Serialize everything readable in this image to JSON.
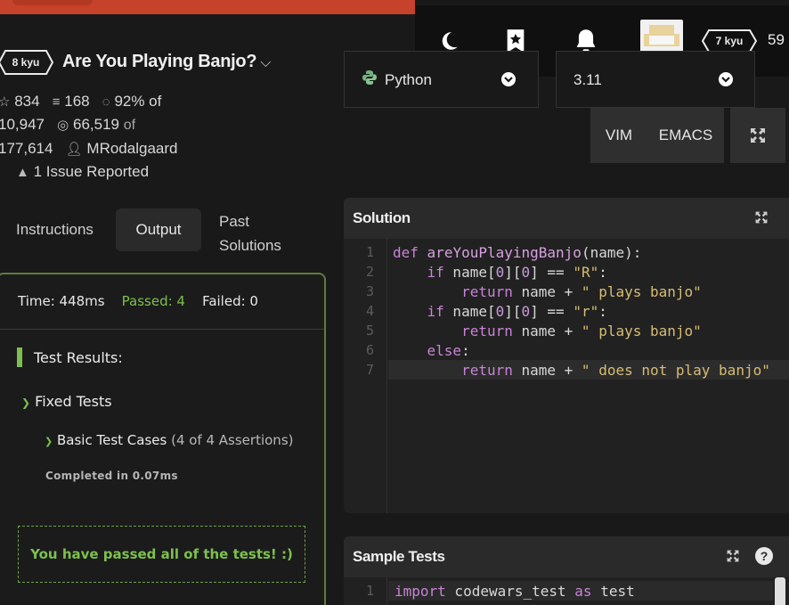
{
  "colors": {
    "accent_red": "#c7422b",
    "passed_green": "#7cc04e",
    "bg": "#191919"
  },
  "nav": {
    "icons": [
      "moon-icon",
      "bookmark-star-icon",
      "bell-icon"
    ],
    "user_rank": "7 kyu",
    "honor": "59"
  },
  "kata": {
    "rank": "8 kyu",
    "title": "Are You Playing Banjo?",
    "stars": "834",
    "collections": "168",
    "satisfaction": "92% of",
    "votes_count": "10,947",
    "completed": "66,519",
    "completed_of": "of",
    "attempts": "177,614",
    "author": "MRodalgaard",
    "issues": "1 Issue Reported"
  },
  "tabs": {
    "instructions": "Instructions",
    "output": "Output",
    "past_line1": "Past",
    "past_line2": "Solutions"
  },
  "output": {
    "time_label": "Time: 448ms",
    "passed_label": "Passed: 4",
    "failed_label": "Failed: 0",
    "test_results": "Test Results:",
    "fixed_tests": "Fixed Tests",
    "basic_cases": "Basic Test Cases",
    "assertions": "(4 of 4 Assertions)",
    "completed_in": "Completed in 0.07ms",
    "all_passed": "You have passed all of the tests! :)"
  },
  "editor": {
    "language": "Python",
    "version": "3.11",
    "vim": "VIM",
    "emacs": "EMACS",
    "solution_title": "Solution",
    "sample_title": "Sample Tests",
    "line_numbers": [
      "1",
      "2",
      "3",
      "4",
      "5",
      "6",
      "7"
    ],
    "sample_line_numbers": [
      "1"
    ]
  }
}
